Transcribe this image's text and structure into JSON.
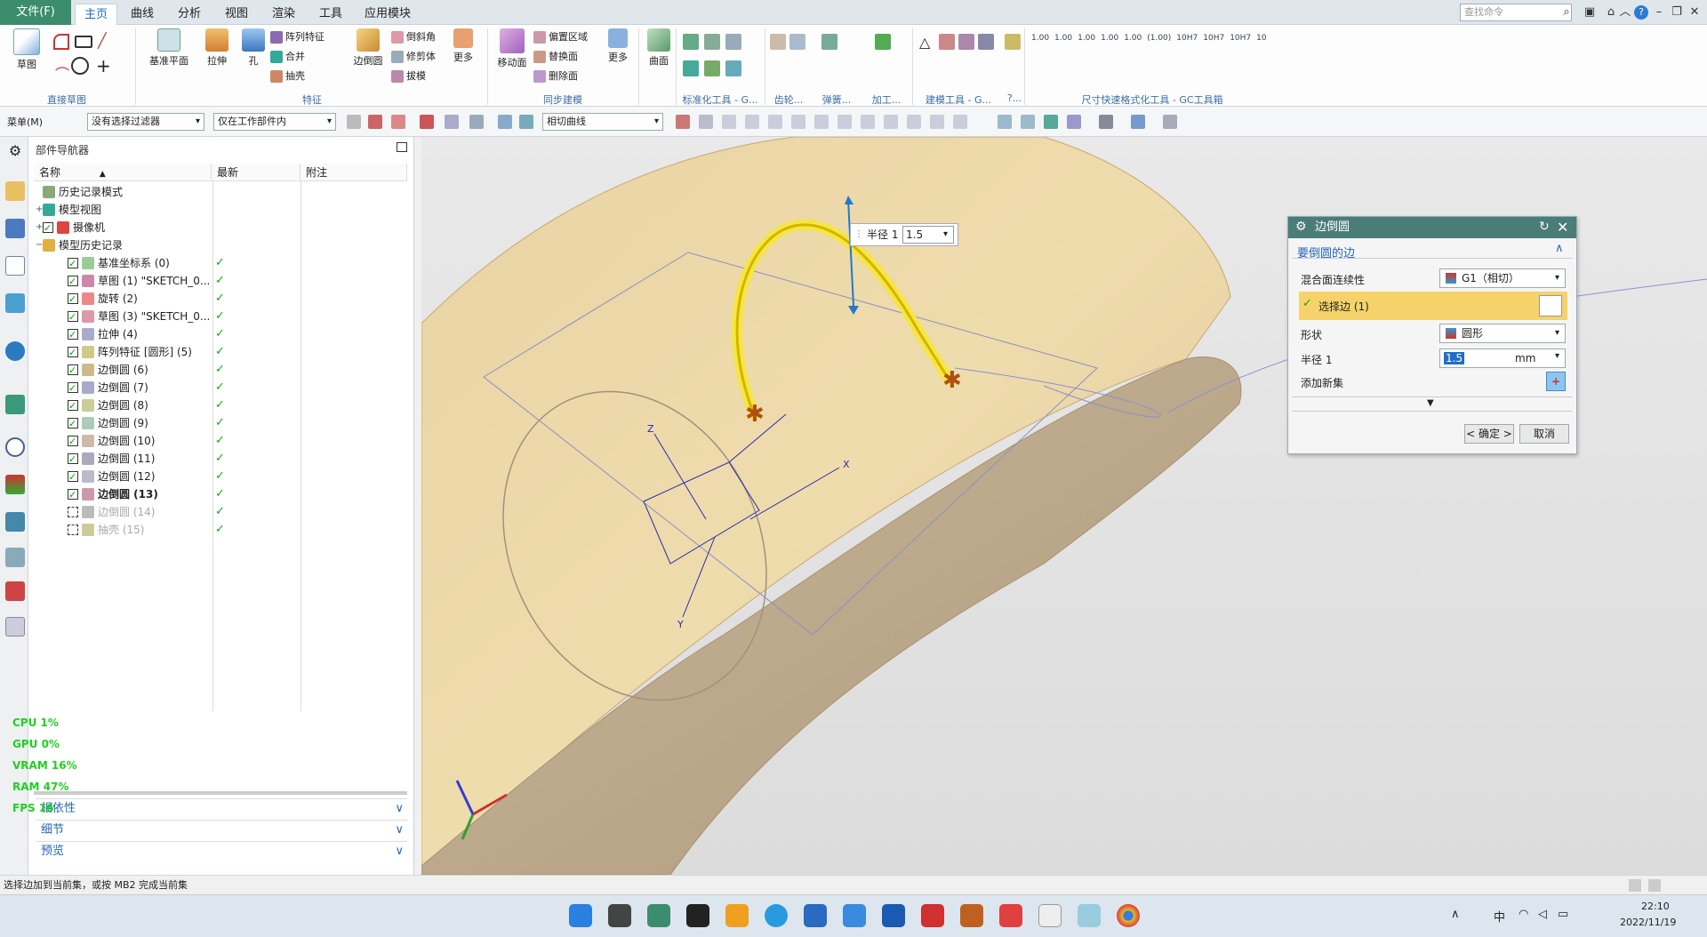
{
  "titlebar": {
    "file_label": "文件(F)",
    "tabs": [
      "主页",
      "曲线",
      "分析",
      "视图",
      "渲染",
      "工具",
      "应用模块"
    ],
    "search_placeholder": "查找命令"
  },
  "ribbon": {
    "sketch": "草图",
    "group_direct_sketch": "直接草图",
    "datum_plane": "基准平面",
    "extrude": "拉伸",
    "hole": "孔",
    "pattern_feature": "阵列特征",
    "unite": "合并",
    "shell": "抽壳",
    "edge_blend": "边倒圆",
    "chamfer": "倒斜角",
    "trim_body": "修剪体",
    "draft": "拔模",
    "more1": "更多",
    "group_feature": "特征",
    "move_face": "移动面",
    "offset_region": "偏置区域",
    "replace_face": "替换面",
    "delete_face": "删除面",
    "more2": "更多",
    "group_sync": "同步建模",
    "surface": "曲面",
    "group_std": "标准化工具 - G...",
    "group_gear": "齿轮...",
    "group_spring": "弹簧...",
    "group_machining": "加工...",
    "group_modeling_tools": "建模工具 - G...",
    "group_q": "?...",
    "group_dim": "尺寸快速格式化工具 - GC工具箱",
    "dim_values": [
      "1.00",
      "1.00",
      "1.00",
      "1.00",
      "1.00",
      "(1.00)",
      "10H7",
      "10H7",
      "10H7",
      "10"
    ]
  },
  "toolbar2": {
    "menu": "菜单(M)",
    "filter": "没有选择过滤器",
    "scope": "仅在工作部件内",
    "curve_rule": "相切曲线"
  },
  "navigator": {
    "title": "部件导航器",
    "columns": [
      "名称",
      "最新",
      "附注"
    ],
    "rows": [
      {
        "label": "历史记录模式",
        "checked": false,
        "latest": false,
        "indent": 0,
        "dim": false,
        "bold": false
      },
      {
        "label": "模型视图",
        "checked": false,
        "latest": false,
        "indent": 0,
        "dim": false,
        "bold": false
      },
      {
        "label": "摄像机",
        "checked": true,
        "latest": false,
        "indent": 0,
        "dim": false,
        "bold": false
      },
      {
        "label": "模型历史记录",
        "checked": false,
        "latest": false,
        "indent": 0,
        "dim": false,
        "bold": false
      },
      {
        "label": "基准坐标系 (0)",
        "checked": true,
        "latest": true,
        "indent": 1,
        "dim": false,
        "bold": false
      },
      {
        "label": "草图 (1) \"SKETCH_0...",
        "checked": true,
        "latest": true,
        "indent": 1,
        "dim": false,
        "bold": false
      },
      {
        "label": "旋转 (2)",
        "checked": true,
        "latest": true,
        "indent": 1,
        "dim": false,
        "bold": false
      },
      {
        "label": "草图 (3) \"SKETCH_0...",
        "checked": true,
        "latest": true,
        "indent": 1,
        "dim": false,
        "bold": false
      },
      {
        "label": "拉伸 (4)",
        "checked": true,
        "latest": true,
        "indent": 1,
        "dim": false,
        "bold": false
      },
      {
        "label": "阵列特征 [圆形] (5)",
        "checked": true,
        "latest": true,
        "indent": 1,
        "dim": false,
        "bold": false
      },
      {
        "label": "边倒圆 (6)",
        "checked": true,
        "latest": true,
        "indent": 1,
        "dim": false,
        "bold": false
      },
      {
        "label": "边倒圆 (7)",
        "checked": true,
        "latest": true,
        "indent": 1,
        "dim": false,
        "bold": false
      },
      {
        "label": "边倒圆 (8)",
        "checked": true,
        "latest": true,
        "indent": 1,
        "dim": false,
        "bold": false
      },
      {
        "label": "边倒圆 (9)",
        "checked": true,
        "latest": true,
        "indent": 1,
        "dim": false,
        "bold": false
      },
      {
        "label": "边倒圆 (10)",
        "checked": true,
        "latest": true,
        "indent": 1,
        "dim": false,
        "bold": false
      },
      {
        "label": "边倒圆 (11)",
        "checked": true,
        "latest": true,
        "indent": 1,
        "dim": false,
        "bold": false
      },
      {
        "label": "边倒圆 (12)",
        "checked": true,
        "latest": true,
        "indent": 1,
        "dim": false,
        "bold": false
      },
      {
        "label": "边倒圆 (13)",
        "checked": true,
        "latest": true,
        "indent": 1,
        "dim": false,
        "bold": true
      },
      {
        "label": "边倒圆 (14)",
        "checked": false,
        "latest": true,
        "indent": 1,
        "dim": true,
        "bold": false
      },
      {
        "label": "抽壳 (15)",
        "checked": false,
        "latest": true,
        "indent": 1,
        "dim": true,
        "bold": false
      }
    ],
    "panels": [
      "相依性",
      "细节",
      "预览"
    ]
  },
  "perf": [
    "CPU   1%",
    "GPU   0%",
    "VRAM  16%",
    "RAM  47%",
    "FPS  16"
  ],
  "viewport": {
    "radius_label": "半径 1",
    "radius_value": "1.5",
    "axes": [
      "X",
      "Y",
      "Z"
    ]
  },
  "dialog": {
    "title": "边倒圆",
    "section": "要倒圆的边",
    "continuity_label": "混合面连续性",
    "continuity_value": "G1（相切）",
    "select_edge": "选择边 (1)",
    "shape_label": "形状",
    "shape_value": "圆形",
    "radius_label": "半径 1",
    "radius_value": "1.5",
    "radius_unit": "mm",
    "add_set": "添加新集",
    "ok": "< 确定 >",
    "cancel": "取消"
  },
  "status": "选择边加到当前集，或按 MB2 完成当前集",
  "tray": {
    "time": "22:10",
    "date": "2022/11/19",
    "ime": "中"
  }
}
